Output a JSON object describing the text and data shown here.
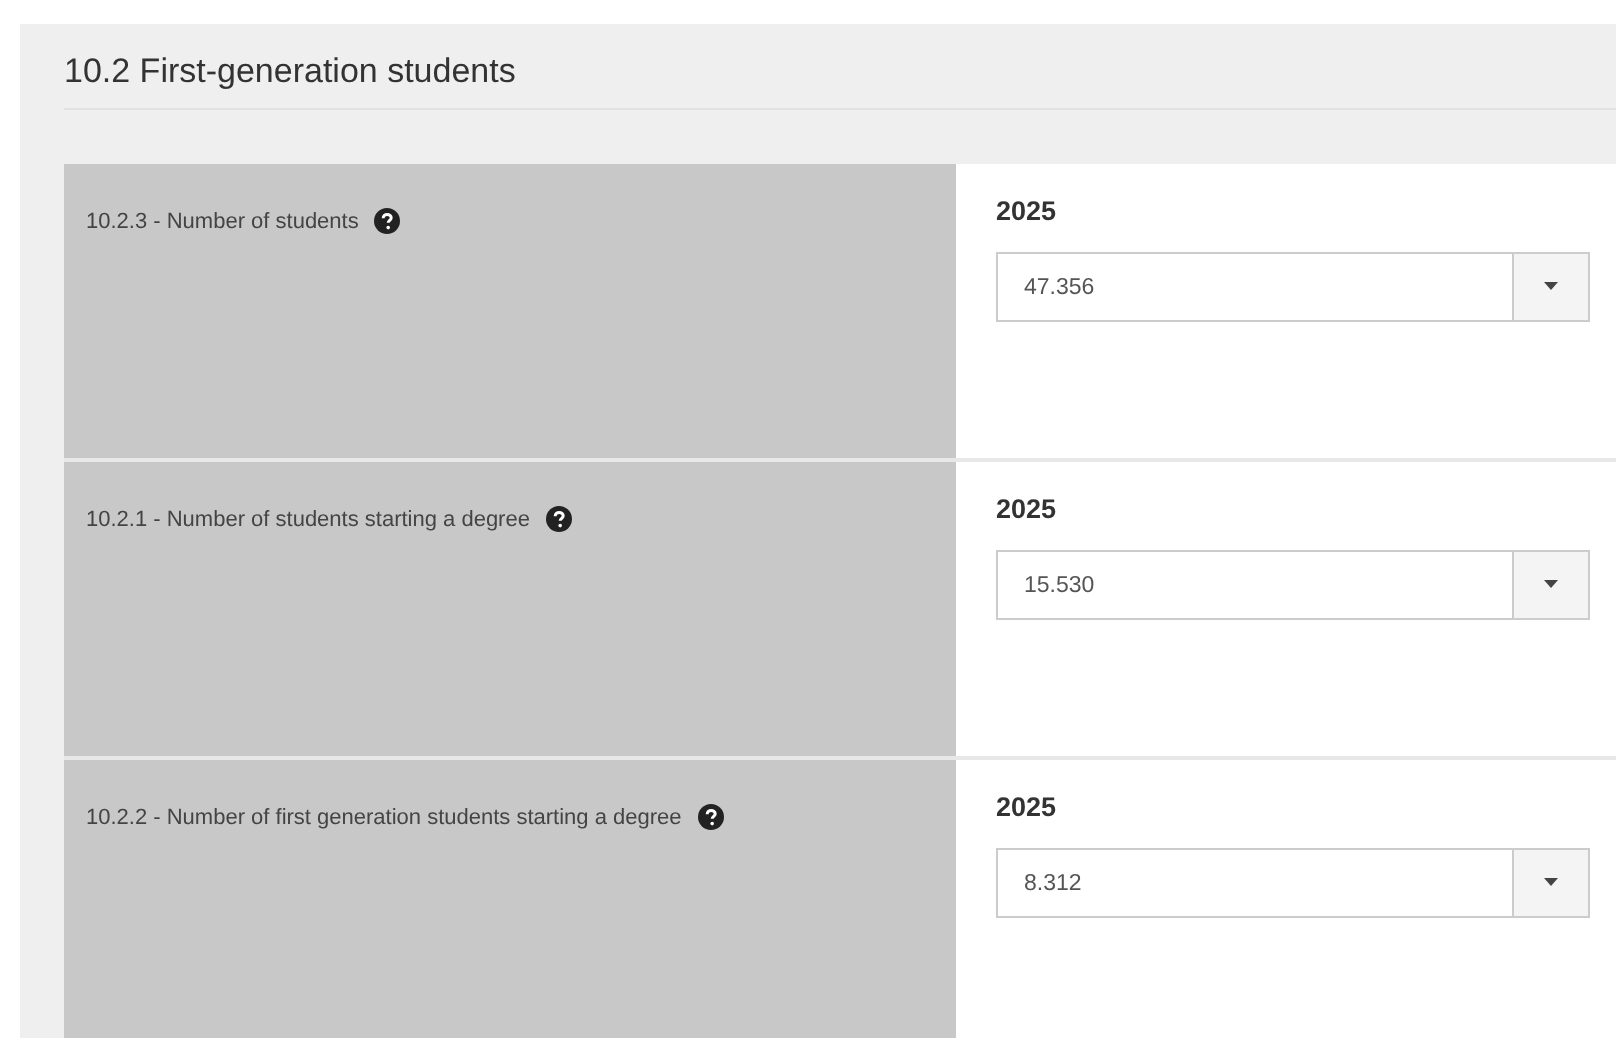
{
  "section": {
    "title": "10.2 First-generation students"
  },
  "rows": [
    {
      "label": "10.2.3 - Number of students",
      "year": "2025",
      "value": "47.356"
    },
    {
      "label": "10.2.1 - Number of students starting a degree",
      "year": "2025",
      "value": "15.530"
    },
    {
      "label": "10.2.2 - Number of first generation students starting a degree",
      "year": "2025",
      "value": "8.312"
    }
  ]
}
